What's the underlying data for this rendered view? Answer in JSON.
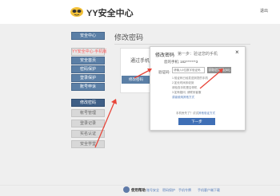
{
  "header": {
    "brand": "YY安全中心",
    "user_link": "退出"
  },
  "sidebar": {
    "items": [
      {
        "label": "安全中心"
      },
      {
        "label": "YY安全中心·手机版"
      },
      {
        "label": "安全首页"
      },
      {
        "label": "密码保护"
      },
      {
        "label": "登录保护"
      },
      {
        "label": "账号申诉"
      },
      {
        "label": "修改密码"
      },
      {
        "label": "帐号管理"
      },
      {
        "label": "登录记录"
      },
      {
        "label": "实名认证"
      },
      {
        "label": "安全学堂"
      }
    ]
  },
  "content": {
    "title": "修改密码",
    "card_label": "通过手机验证修改",
    "card_button": "修改密码"
  },
  "modal": {
    "title": "修改密码",
    "step": "第一步：验证您的手机",
    "close": "×",
    "phone_label": "您的手机:",
    "phone_value": "182*******3",
    "code_label": "验证码:",
    "code_placeholder": "请输入6位数字验证码",
    "send_button": "获取验证码(60)",
    "notes": [
      "1.验证码已经发送到您的手机",
      "2.如长时间未收到",
      "   请检查手机是否停机",
      "3.如有疑问, 请联系客服",
      "   或者使用其他方式"
    ],
    "footer_text": "手机丢失了？试试",
    "footer_link": "其他验证方式",
    "next_button": "下一步"
  },
  "footer": {
    "label": "使用帮助",
    "links": [
      "账号安全",
      "密码保护",
      "手机令牌",
      "手机客户端下载"
    ]
  },
  "colors": {
    "sidebar_blue": "#5b7fa6",
    "primary_button": "#3f6fb6",
    "arrow_red": "#e8463a"
  }
}
